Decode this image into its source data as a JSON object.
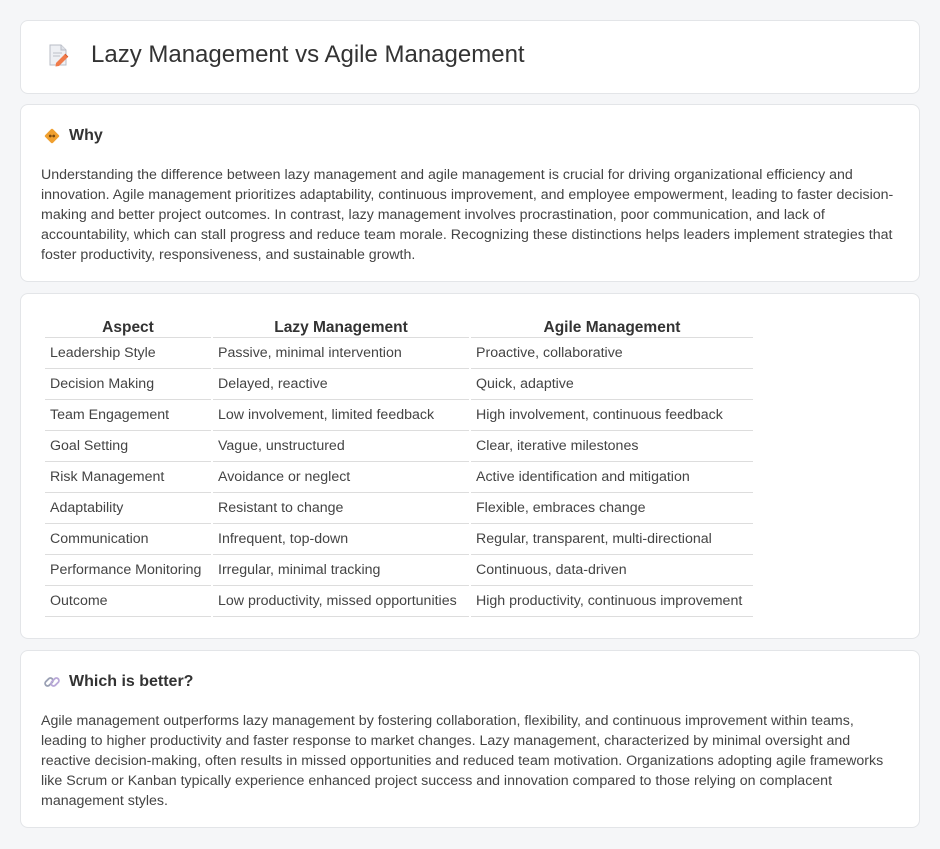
{
  "header": {
    "title": "Lazy Management vs Agile Management",
    "icon": "document-pencil-icon"
  },
  "why": {
    "icon": "diamond-sign-icon",
    "title": "Why",
    "text": "Understanding the difference between lazy management and agile management is crucial for driving organizational efficiency and innovation. Agile management prioritizes adaptability, continuous improvement, and employee empowerment, leading to faster decision-making and better project outcomes. In contrast, lazy management involves procrastination, poor communication, and lack of accountability, which can stall progress and reduce team morale. Recognizing these distinctions helps leaders implement strategies that foster productivity, responsiveness, and sustainable growth."
  },
  "table": {
    "headers": [
      "Aspect",
      "Lazy Management",
      "Agile Management"
    ],
    "rows": [
      [
        "Leadership Style",
        "Passive, minimal intervention",
        "Proactive, collaborative"
      ],
      [
        "Decision Making",
        "Delayed, reactive",
        "Quick, adaptive"
      ],
      [
        "Team Engagement",
        "Low involvement, limited feedback",
        "High involvement, continuous feedback"
      ],
      [
        "Goal Setting",
        "Vague, unstructured",
        "Clear, iterative milestones"
      ],
      [
        "Risk Management",
        "Avoidance or neglect",
        "Active identification and mitigation"
      ],
      [
        "Adaptability",
        "Resistant to change",
        "Flexible, embraces change"
      ],
      [
        "Communication",
        "Infrequent, top-down",
        "Regular, transparent, multi-directional"
      ],
      [
        "Performance Monitoring",
        "Irregular, minimal tracking",
        "Continuous, data-driven"
      ],
      [
        "Outcome",
        "Low productivity, missed opportunities",
        "High productivity, continuous improvement"
      ]
    ]
  },
  "better": {
    "icon": "link-icon",
    "title": "Which is better?",
    "text": "Agile management outperforms lazy management by fostering collaboration, flexibility, and continuous improvement within teams, leading to higher productivity and faster response to market changes. Lazy management, characterized by minimal oversight and reactive decision-making, often results in missed opportunities and reduced team motivation. Organizations adopting agile frameworks like Scrum or Kanban typically experience enhanced project success and innovation compared to those relying on complacent management styles."
  },
  "colors": {
    "background": "#f5f6f8",
    "card_border": "#e3e5e8",
    "text": "#444444",
    "accent_orange": "#f0a030"
  }
}
